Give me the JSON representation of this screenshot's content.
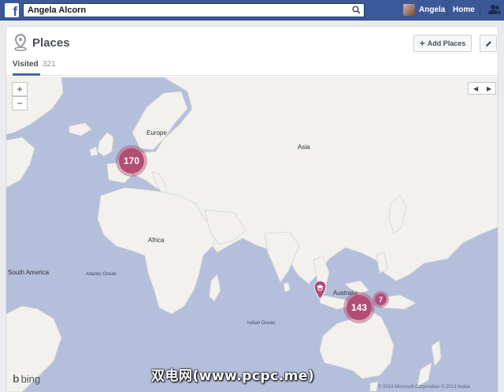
{
  "topbar": {
    "search_value": "Angela Alcorn",
    "user_name": "Angela",
    "home_label": "Home"
  },
  "places": {
    "title": "Places",
    "add_button": "Add Places",
    "tab_label": "Visited",
    "tab_count": "321"
  },
  "map": {
    "zoom_in": "+",
    "zoom_out": "−",
    "prev": "◀",
    "next": "▶",
    "labels": {
      "europe": "Europe",
      "asia": "Asia",
      "africa": "Africa",
      "south_america": "South America",
      "atlantic": "Atlantic Ocean",
      "indian": "Indian Ocean",
      "australia": "Australia"
    },
    "clusters": {
      "europe": "170",
      "australia_main": "143",
      "australia_east": "7"
    },
    "provider": "bing",
    "copyright": "© 2014 Microsoft Corporation  © 2013 Nokia",
    "land_color": "#f2f1ed",
    "water_color": "#b4bfdb",
    "marker_color": "#b24d73"
  },
  "watermark": "双电网(www.pcpc.me)",
  "colors": {
    "brand": "#3b5998",
    "accent": "#4267b2"
  }
}
